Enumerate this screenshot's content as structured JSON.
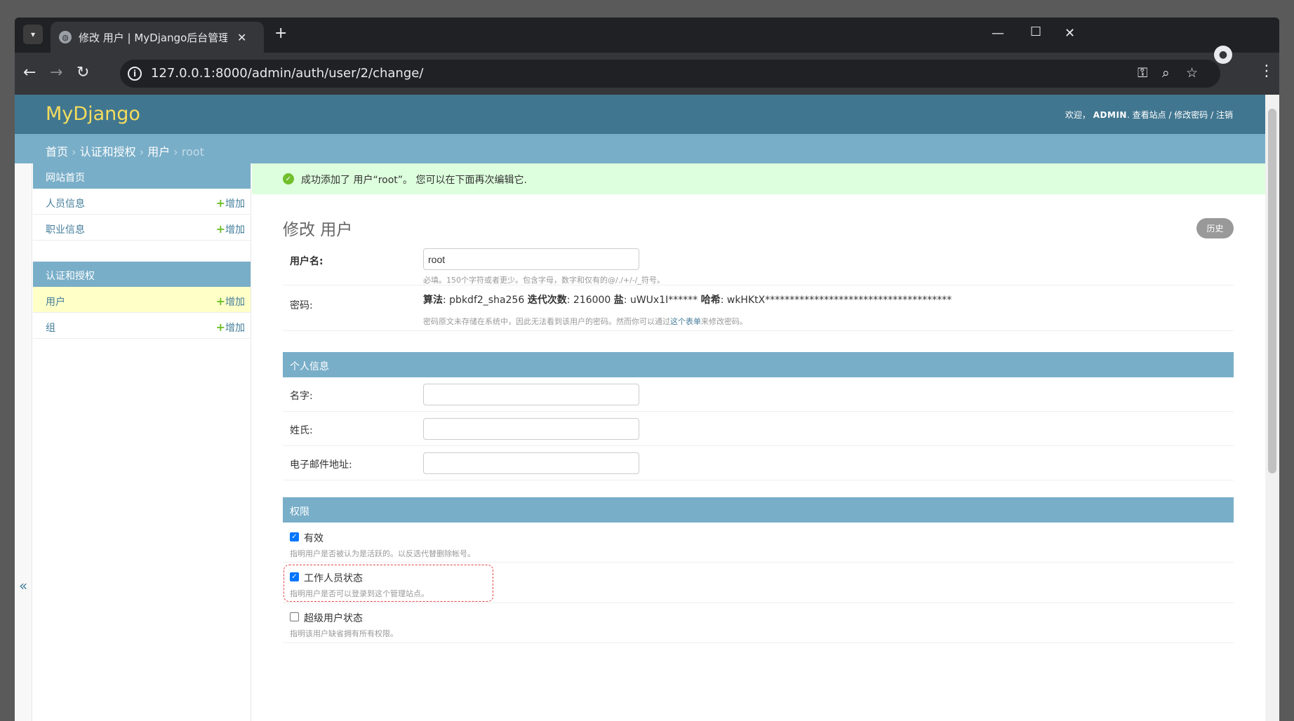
{
  "browser": {
    "tab_title": "修改 用户 | MyDjango后台管理",
    "url": "127.0.0.1:8000/admin/auth/user/2/change/"
  },
  "header": {
    "brand": "MyDjango",
    "welcome": "欢迎，",
    "user": "ADMIN",
    "view_site": "查看站点",
    "change_password": "修改密码",
    "logout": "注销",
    "separator": " / "
  },
  "breadcrumbs": {
    "home": "首页",
    "app": "认证和授权",
    "model": "用户",
    "current": "root",
    "sep": " › "
  },
  "sidebar": {
    "modules": [
      {
        "caption": "网站首页",
        "items": [
          {
            "name": "人员信息",
            "add": "增加"
          },
          {
            "name": "职业信息",
            "add": "增加"
          }
        ]
      },
      {
        "caption": "认证和授权",
        "items": [
          {
            "name": "用户",
            "add": "增加"
          },
          {
            "name": "组",
            "add": "增加"
          }
        ]
      }
    ],
    "collapse_glyph": "«"
  },
  "message": "成功添加了 用户“root”。 您可以在下面再次编辑它.",
  "page": {
    "title": "修改 用户",
    "history": "历史"
  },
  "form": {
    "username": {
      "label": "用户名:",
      "value": "root",
      "help": "必填。150个字符或者更少。包含字母，数字和仅有的@/./+/-/_符号。"
    },
    "password": {
      "label": "密码:",
      "algo_label": "算法",
      "algo": "pbkdf2_sha256",
      "iter_label": "迭代次数",
      "iter": "216000",
      "salt_label": "盐",
      "salt": "uWUx1I******",
      "hash_label": "哈希",
      "hash": "wkHKtX**************************************",
      "help_prefix": "密码原文未存储在系统中，因此无法看到该用户的密码。然而你可以通过",
      "help_link": "这个表单",
      "help_suffix": "来修改密码。"
    },
    "personal": {
      "caption": "个人信息",
      "first_name": "名字:",
      "last_name": "姓氏:",
      "email": "电子邮件地址:"
    },
    "permissions": {
      "caption": "权限",
      "active": {
        "label": "有效",
        "help": "指明用户是否被认为是活跃的。以反选代替删除帐号。",
        "checked": true
      },
      "staff": {
        "label": "工作人员状态",
        "help": "指明用户是否可以登录到这个管理站点。",
        "checked": true
      },
      "superuser": {
        "label": "超级用户状态",
        "help": "指明该用户缺省拥有所有权限。",
        "checked": false
      }
    }
  },
  "colors": {
    "header": "#417690",
    "breadcrumbs": "#79aec8",
    "brand": "#f5dd5d",
    "success_bg": "#ddffdd",
    "add_plus": "#70bf2b",
    "highlight": "#e0434b"
  }
}
